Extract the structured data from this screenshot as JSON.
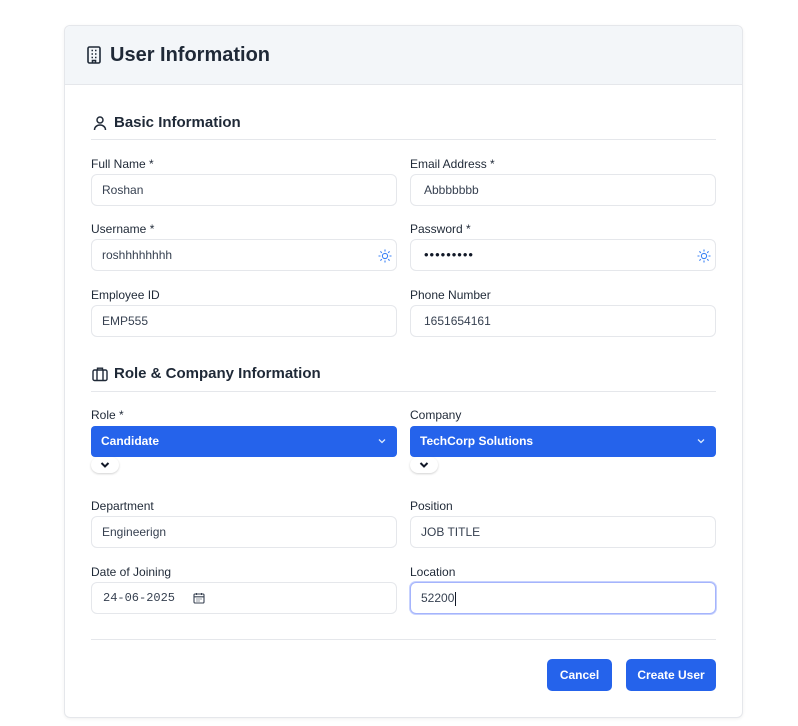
{
  "header": {
    "title": "User Information",
    "icon": "building-icon"
  },
  "basic_info": {
    "title": "Basic Information",
    "icon": "user-icon",
    "full_name": {
      "label": "Full Name *",
      "value": "Roshan"
    },
    "email": {
      "label": "Email Address *",
      "value": "Abbbbbbb"
    },
    "username": {
      "label": "Username *",
      "value": "roshhhhhhhh"
    },
    "password": {
      "label": "Password *",
      "masked": "•••••••••"
    },
    "employee_id": {
      "label": "Employee ID",
      "value": "EMP555"
    },
    "phone": {
      "label": "Phone Number",
      "value": "1651654161"
    }
  },
  "role_company": {
    "title": "Role & Company Information",
    "icon": "briefcase-icon",
    "role": {
      "label": "Role *",
      "value": "Candidate"
    },
    "company": {
      "label": "Company",
      "value": "TechCorp Solutions"
    },
    "department": {
      "label": "Department",
      "value": "Engineerign"
    },
    "position": {
      "label": "Position",
      "value": "JOB TITLE"
    },
    "date_of_joining": {
      "label": "Date of Joining",
      "value": "24-06-2025"
    },
    "location": {
      "label": "Location",
      "value": "52200"
    }
  },
  "actions": {
    "cancel": "Cancel",
    "create": "Create User"
  },
  "colors": {
    "accent": "#2563eb",
    "header_bg": "#f3f6f9",
    "border": "#e5e7eb"
  }
}
